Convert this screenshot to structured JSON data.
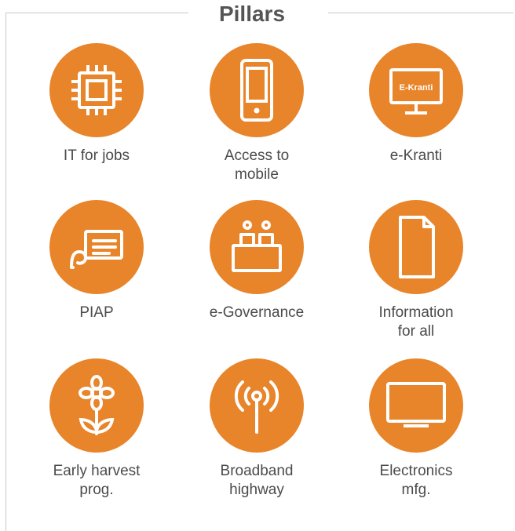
{
  "title": "Pillars",
  "accent_color": "#e8842a",
  "pillars": [
    {
      "label": "IT for jobs",
      "icon": "chip-icon"
    },
    {
      "label": "Access to\nmobile",
      "icon": "mobile-phone-icon"
    },
    {
      "label": "e-Kranti",
      "icon": "monitor-icon",
      "icon_text": "E-Kranti"
    },
    {
      "label": "PIAP",
      "icon": "presentation-board-icon"
    },
    {
      "label": "e-Governance",
      "icon": "governance-desk-icon"
    },
    {
      "label": "Information\nfor all",
      "icon": "document-icon"
    },
    {
      "label": "Early harvest\nprog.",
      "icon": "flower-icon"
    },
    {
      "label": "Broadband\nhighway",
      "icon": "broadcast-antenna-icon"
    },
    {
      "label": "Electronics\nmfg.",
      "icon": "tv-screen-icon"
    }
  ]
}
